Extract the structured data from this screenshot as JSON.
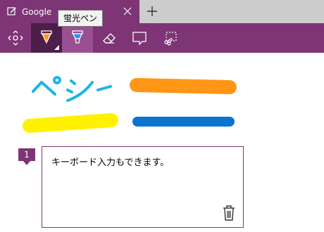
{
  "tab": {
    "title": "Google",
    "new_tab_symbol": "+"
  },
  "tooltip": {
    "text": "蛍光ペン"
  },
  "toolbar": {
    "tools": [
      {
        "name": "pan-icon",
        "state": "normal"
      },
      {
        "name": "ballpoint-pen-icon",
        "state": "selected"
      },
      {
        "name": "highlighter-icon",
        "state": "hover"
      },
      {
        "name": "eraser-icon",
        "state": "normal"
      },
      {
        "name": "add-note-icon",
        "state": "normal"
      },
      {
        "name": "clip-icon",
        "state": "normal"
      }
    ]
  },
  "canvas": {
    "handwriting_text": "ペン",
    "strokes": [
      {
        "kind": "pen",
        "color": "#1eb4e6"
      },
      {
        "kind": "highlighter",
        "color": "#ff9616"
      },
      {
        "kind": "highlighter",
        "color": "#fff100"
      },
      {
        "kind": "pen",
        "color": "#0a74cf"
      }
    ]
  },
  "note": {
    "number": "1",
    "text": "キーボード入力もできます。"
  },
  "colors": {
    "accent": "#7d3575",
    "selected_tool": "#4d1e49",
    "hover_tool": "#9a4f92",
    "tab_strip": "#cdcdcd"
  }
}
